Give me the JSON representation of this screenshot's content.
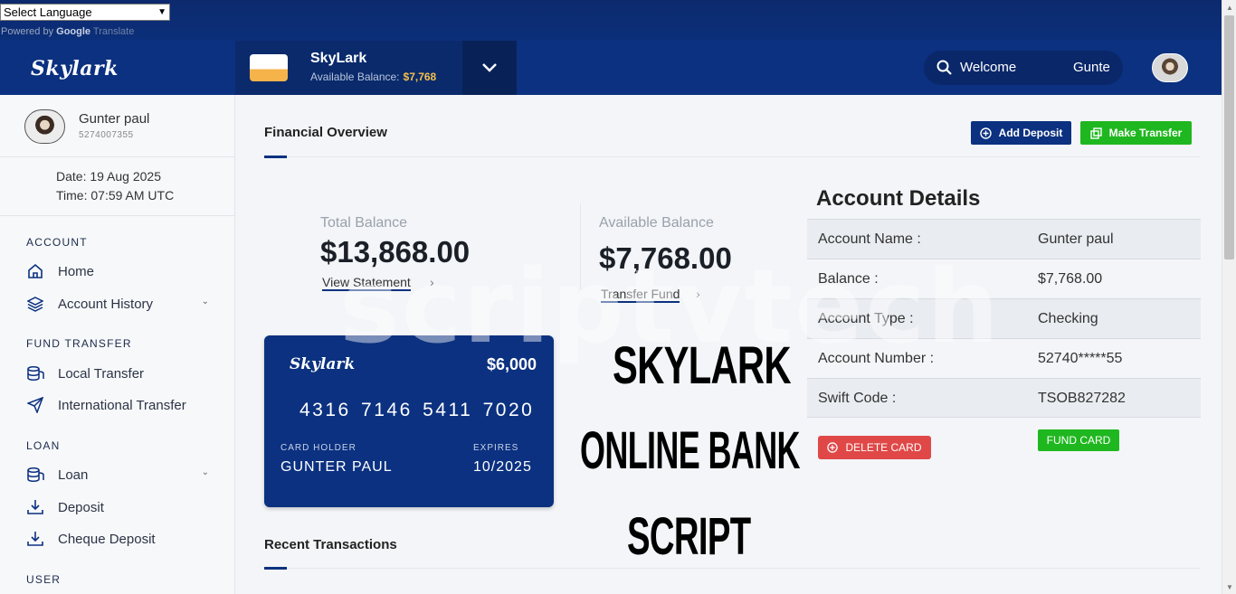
{
  "translate": {
    "select_label": "Select Language",
    "powered_prefix": "Powered by",
    "google": "Google",
    "translate": "Translate"
  },
  "header": {
    "logo": "Skylark",
    "account_name": "SkyLark",
    "balance_label": "Available Balance:",
    "balance_value": "$7,768",
    "welcome": "Welcome",
    "user_short": "Gunte"
  },
  "sidebar": {
    "user_name": "Gunter paul",
    "account_number": "5274007355",
    "date": "Date: 19 Aug 2025",
    "time": "Time: 07:59 AM UTC",
    "sections": {
      "account": "ACCOUNT",
      "fund_transfer": "FUND TRANSFER",
      "loan": "LOAN",
      "user": "USER"
    },
    "items": {
      "home": "Home",
      "account_history": "Account History",
      "local_transfer": "Local Transfer",
      "international_transfer": "International Transfer",
      "loan": "Loan",
      "deposit": "Deposit",
      "cheque_deposit": "Cheque Deposit"
    }
  },
  "main": {
    "title": "Financial Overview",
    "add_deposit": "Add Deposit",
    "make_transfer": "Make Transfer",
    "total_balance_label": "Total Balance",
    "total_balance_value": "$13,868.00",
    "view_statement": "View Statement",
    "available_balance_label": "Available Balance",
    "available_balance_value": "$7,768.00",
    "transfer_fund": "Transfer Fund",
    "recent_transactions": "Recent Transactions",
    "watermark": "scriptvtech"
  },
  "card": {
    "logo": "Skylark",
    "amount": "$6,000",
    "number": "4316 7146 5411 7020",
    "holder_label": "CARD HOLDER",
    "holder": "GUNTER PAUL",
    "expires_label": "EXPIRES",
    "expires": "10/2025"
  },
  "promo": {
    "line1": "SKYLARK",
    "line2": "ONLINE BANK",
    "line3": "SCRIPT"
  },
  "account_details": {
    "title": "Account Details",
    "rows": [
      {
        "key": "Account Name :",
        "value": "Gunter paul"
      },
      {
        "key": "Balance :",
        "value": "$7,768.00"
      },
      {
        "key": "Account Type :",
        "value": "Checking"
      },
      {
        "key": "Account Number :",
        "value": "52740*****55"
      },
      {
        "key": "Swift Code :",
        "value": "TSOB827282"
      }
    ],
    "delete_card": "DELETE CARD",
    "fund_card": "FUND CARD"
  },
  "colors": {
    "primary": "#0b3180",
    "success": "#1fb71f",
    "danger": "#e04848",
    "gold": "#f5c04a"
  }
}
